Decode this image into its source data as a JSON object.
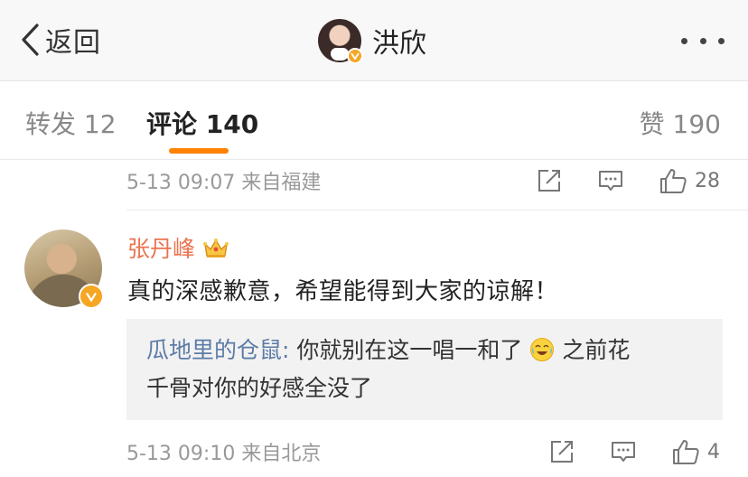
{
  "header": {
    "back_label": "返回",
    "title": "洪欣",
    "verified_badge_color": "#f5a623"
  },
  "tabs": {
    "repost": "转发 12",
    "comment": "评论 140",
    "like": "赞 190",
    "active": "comment",
    "accent_color": "#ff8200"
  },
  "comments": [
    {
      "meta": "5-13 09:07  来自福建",
      "likes": "28"
    },
    {
      "user": "张丹峰",
      "user_color": "#eb7350",
      "badge": "crown-icon",
      "text": "真的深感歉意，希望能得到大家的谅解！",
      "reply": {
        "user": "瓜地里的仓鼠:",
        "line1_before": " 你就别在这一唱一和了",
        "line1_after": "之前花",
        "line2": "千骨对你的好感全没了",
        "emoji": "laugh-cry-emoji"
      },
      "meta": "5-13 09:10  来自北京",
      "likes": "4"
    }
  ]
}
